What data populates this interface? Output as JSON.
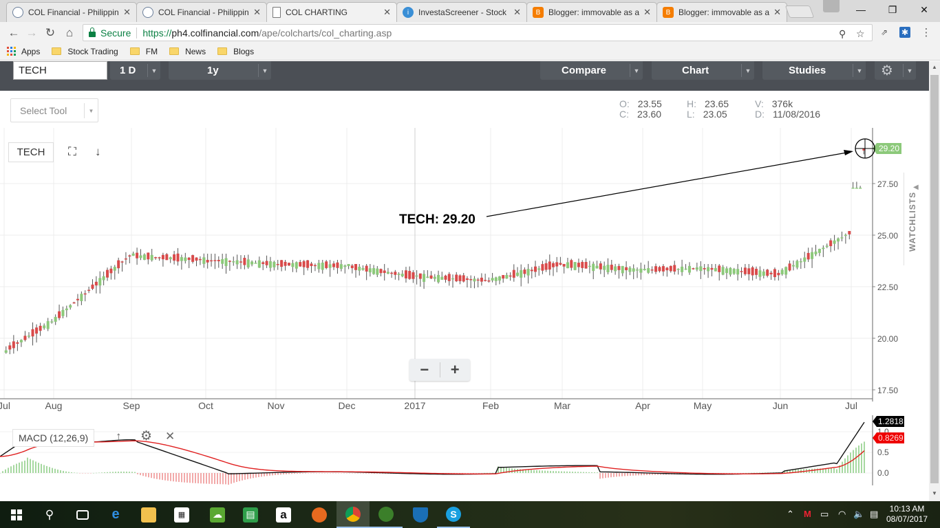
{
  "browser": {
    "tabs": [
      {
        "label": "COL Financial - Philippin",
        "icon": "globe-icon"
      },
      {
        "label": "COL Financial - Philippin",
        "icon": "globe-icon"
      },
      {
        "label": "COL CHARTING",
        "icon": "document-icon",
        "active": true
      },
      {
        "label": "InvestaScreener - Stock",
        "icon": "investa-icon"
      },
      {
        "label": "Blogger: immovable as a",
        "icon": "blogger-icon"
      },
      {
        "label": "Blogger: immovable as a",
        "icon": "blogger-icon"
      }
    ],
    "address": {
      "secure_label": "Secure",
      "scheme": "https://",
      "host": "ph4.colfinancial.com",
      "path": "/ape/colcharts/col_charting.asp"
    },
    "bookmarks": [
      {
        "label": "Apps",
        "icon": "apps-grid-icon"
      },
      {
        "label": "Stock Trading",
        "icon": "folder-icon"
      },
      {
        "label": "FM",
        "icon": "folder-icon"
      },
      {
        "label": "News",
        "icon": "folder-icon"
      },
      {
        "label": "Blogs",
        "icon": "folder-icon"
      }
    ]
  },
  "app": {
    "symbol": "TECH",
    "interval": "1 D",
    "range": "1y",
    "compare_label": "Compare",
    "chart_label": "Chart",
    "studies_label": "Studies",
    "select_tool_label": "Select Tool",
    "ohlc": {
      "o_key": "O:",
      "o": "23.55",
      "h_key": "H:",
      "h": "23.65",
      "v_key": "V:",
      "v": "376k",
      "c_key": "C:",
      "c": "23.60",
      "l_key": "L:",
      "l": "23.05",
      "d_key": "D:",
      "d": "11/08/2016"
    },
    "chart_symbol": "TECH",
    "annotation": "TECH: 29.20",
    "last_price": "29.20",
    "watchlists_label": "WATCHLISTS",
    "macd_label": "MACD (12,26,9)",
    "macd_values": {
      "macd": "1.2818",
      "signal": "0.8269"
    },
    "colors": {
      "up": "#8cc97a",
      "down": "#d94a4a",
      "wick": "#555555",
      "macd": "#111111",
      "signal": "#e02020",
      "price_tag": "#8cc97a"
    }
  },
  "chart_data": [
    {
      "type": "candlestick",
      "title": "TECH",
      "x_ticks": [
        "Jul",
        "Aug",
        "Sep",
        "Oct",
        "Nov",
        "Dec",
        "2017",
        "Feb",
        "Mar",
        "Apr",
        "May",
        "Jun",
        "Jul"
      ],
      "y_ticks": [
        "17.50",
        "20.00",
        "22.50",
        "25.00",
        "27.50"
      ],
      "ylim": [
        17.5,
        30.0
      ],
      "grid": true,
      "monthly_closes": [
        {
          "month": "Jul 2016",
          "low": 17.6,
          "high": 21.6,
          "close": 20.8
        },
        {
          "month": "Aug 2016",
          "low": 19.8,
          "high": 24.2,
          "close": 24.0
        },
        {
          "month": "Sep 2016",
          "low": 23.2,
          "high": 25.1,
          "close": 23.8
        },
        {
          "month": "Oct 2016",
          "low": 23.0,
          "high": 24.1,
          "close": 23.6
        },
        {
          "month": "Nov 2016",
          "low": 22.5,
          "high": 23.8,
          "close": 23.5
        },
        {
          "month": "Dec 2016",
          "low": 22.2,
          "high": 23.6,
          "close": 23.0
        },
        {
          "month": "Jan 2017",
          "low": 22.3,
          "high": 23.3,
          "close": 22.8
        },
        {
          "month": "Feb 2017",
          "low": 22.4,
          "high": 24.1,
          "close": 23.6
        },
        {
          "month": "Mar 2017",
          "low": 22.8,
          "high": 23.9,
          "close": 23.3
        },
        {
          "month": "Apr 2017",
          "low": 22.7,
          "high": 23.9,
          "close": 23.4
        },
        {
          "month": "May 2017",
          "low": 22.8,
          "high": 23.6,
          "close": 23.1
        },
        {
          "month": "Jun 2017",
          "low": 22.9,
          "high": 25.2,
          "close": 25.1
        },
        {
          "month": "Jul 2017",
          "low": 27.3,
          "high": 29.2,
          "close": 29.2
        }
      ]
    },
    {
      "type": "line",
      "title": "MACD (12,26,9)",
      "y_ticks": [
        "0.0",
        "0.5",
        "1.0"
      ],
      "series": [
        {
          "name": "MACD",
          "last": 1.2818
        },
        {
          "name": "Signal",
          "last": 0.8269
        }
      ]
    }
  ],
  "taskbar": {
    "apps": [
      "start-icon",
      "search-icon",
      "task-view-icon",
      "edge-icon",
      "file-explorer-icon",
      "store-icon",
      "money-icon",
      "notes-icon",
      "amazon-icon",
      "firefox-icon",
      "chrome-icon",
      "game-icon",
      "defender-icon",
      "skype-icon"
    ],
    "time": "10:13 AM",
    "date": "08/07/2017"
  }
}
